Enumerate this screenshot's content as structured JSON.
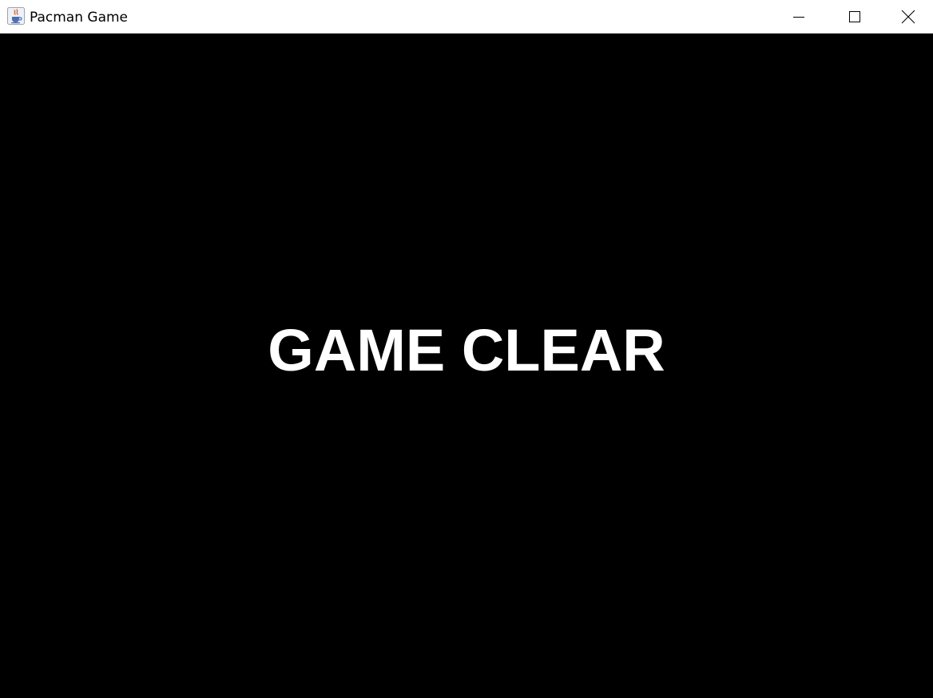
{
  "window": {
    "title": "Pacman Game",
    "icon": "java-coffee-cup-icon",
    "controls": {
      "minimize": "minimize-icon",
      "maximize": "maximize-icon",
      "close": "close-icon"
    }
  },
  "game": {
    "background_color": "#000000",
    "text_color": "#ffffff",
    "status_message": "GAME CLEAR"
  }
}
